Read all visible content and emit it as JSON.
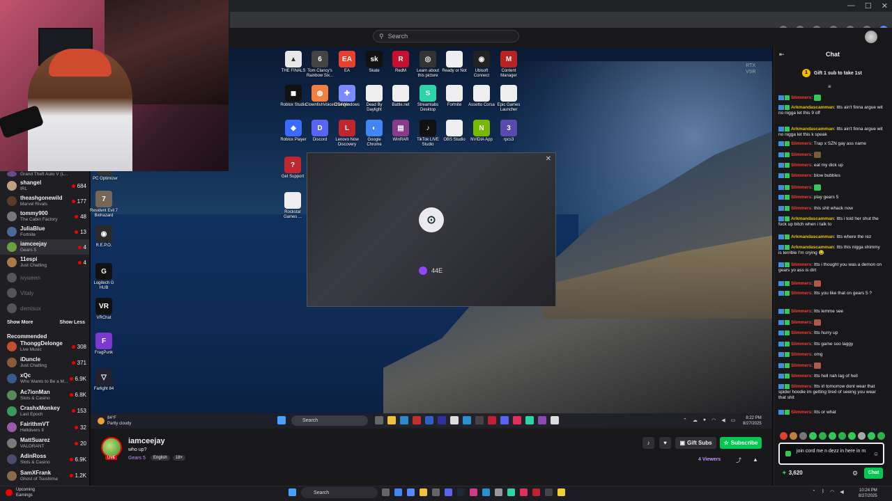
{
  "browser": {
    "window_controls": [
      "—",
      "☐",
      "✕"
    ]
  },
  "twitch_header": {
    "search_placeholder": "Search"
  },
  "sidebar": {
    "followed": [
      {
        "name": "Grand Theft Auto V (L...",
        "game": "",
        "count": "",
        "color": "#6a4a8a",
        "partial": true
      },
      {
        "name": "shangel",
        "game": "IRL",
        "count": "684",
        "color": "#c0a080"
      },
      {
        "name": "theashgonewild",
        "game": "Marvel Rivals",
        "count": "177",
        "color": "#5a3a2a"
      },
      {
        "name": "tommy900",
        "game": "The Cabin Factory",
        "count": "48",
        "color": "#777"
      },
      {
        "name": "JuliaBlue",
        "game": "Fortnite",
        "count": "13",
        "color": "#4a6a9a"
      },
      {
        "name": "iamceejay",
        "game": "Gears 5",
        "count": "4",
        "color": "#6aa040",
        "active": true
      },
      {
        "name": "11espi",
        "game": "Just Chatting",
        "count": "4",
        "color": "#aa7a4a"
      },
      {
        "name": "ivyween",
        "game": "",
        "count": "",
        "color": "#555",
        "offline": true
      },
      {
        "name": "Vitaly",
        "game": "",
        "count": "",
        "color": "#555",
        "offline": true
      },
      {
        "name": "demisux",
        "game": "",
        "count": "",
        "color": "#555",
        "offline": true
      }
    ],
    "show_more": "Show More",
    "show_less": "Show Less",
    "recommended_title": "Recommended",
    "recommended": [
      {
        "name": "ThonggDelonge",
        "game": "Live Music",
        "count": "308",
        "color": "#c05030"
      },
      {
        "name": "iDuncle",
        "game": "Just Chatting",
        "count": "371",
        "color": "#8a5a3a"
      },
      {
        "name": "xQc",
        "game": "Who Wants to Be a M...",
        "count": "6.9K",
        "color": "#3a5a8a"
      },
      {
        "name": "Ac7ionMan",
        "game": "Slots & Casino",
        "count": "6.8K",
        "color": "#5a8a5a"
      },
      {
        "name": "CrashxMonkey",
        "game": "Last Epoch",
        "count": "153",
        "color": "#3a9a5a"
      },
      {
        "name": "FairithmVT",
        "game": "Helldivers II",
        "count": "32",
        "color": "#9a5aaa"
      },
      {
        "name": "MattSuarez",
        "game": "VALORANT",
        "count": "20",
        "color": "#7a7a7a"
      },
      {
        "name": "AdinRoss",
        "game": "Slots & Casino",
        "count": "6.9K",
        "color": "#4a4a6a"
      },
      {
        "name": "SamXFrank",
        "game": "Ghost of Tsushima",
        "count": "1.2K",
        "color": "#8a6a4a"
      }
    ]
  },
  "desktop": {
    "rtx_label": "RTX\nVSR",
    "icons": [
      {
        "label": "THE FINALS",
        "color": "#e8e8e8",
        "glyph": "▲"
      },
      {
        "label": "Tom Clancy's Rainbow Six...",
        "color": "#444",
        "glyph": "6"
      },
      {
        "label": "EA",
        "color": "#e8402c",
        "glyph": "EA"
      },
      {
        "label": "Skate",
        "color": "#111",
        "glyph": "sk"
      },
      {
        "label": "RedM",
        "color": "#c8102e",
        "glyph": "R"
      },
      {
        "label": "Learn about this picture",
        "color": "#333",
        "glyph": "◎"
      },
      {
        "label": "Ready or Not",
        "color": "#eee",
        "glyph": ""
      },
      {
        "label": "Ubisoft Connect",
        "color": "#222",
        "glyph": "◉"
      },
      {
        "label": "Content Manager",
        "color": "#b22",
        "glyph": "M"
      },
      {
        "label": "Roblox Studio",
        "color": "#111",
        "glyph": "◼"
      },
      {
        "label": "ClownfishVoiceChanger",
        "color": "#f08040",
        "glyph": "◍"
      },
      {
        "label": "DS4Windows",
        "color": "#7a8aff",
        "glyph": "✚"
      },
      {
        "label": "Dead By Daylight",
        "color": "#eee",
        "glyph": ""
      },
      {
        "label": "Battle.net",
        "color": "#eee",
        "glyph": ""
      },
      {
        "label": "Streamlabs Desktop",
        "color": "#2dd4a6",
        "glyph": "S"
      },
      {
        "label": "Fortnite",
        "color": "#eee",
        "glyph": ""
      },
      {
        "label": "Assetto Corsa",
        "color": "#eee",
        "glyph": ""
      },
      {
        "label": "Epic Games Launcher",
        "color": "#eee",
        "glyph": ""
      },
      {
        "label": "Roblox Player",
        "color": "#3a6aff",
        "glyph": "◆"
      },
      {
        "label": "Discord",
        "color": "#5865f2",
        "glyph": "D"
      },
      {
        "label": "Lenovo Now Discovery",
        "color": "#c0262e",
        "glyph": "L"
      },
      {
        "label": "Google Chrome",
        "color": "#4285f4",
        "glyph": "◐"
      },
      {
        "label": "WinRAR",
        "color": "#8a3a8a",
        "glyph": "▤"
      },
      {
        "label": "TikTok LIVE Studio",
        "color": "#111",
        "glyph": "♪"
      },
      {
        "label": "OBS Studio",
        "color": "#eee",
        "glyph": ""
      },
      {
        "label": "NVIDIA App",
        "color": "#76b900",
        "glyph": "N"
      },
      {
        "label": "rpcs3",
        "color": "#5a4ab0",
        "glyph": "3"
      },
      {
        "label": "Get Support",
        "color": "#c0262e",
        "glyph": "?"
      },
      {
        "label": "Rockstar Games ...",
        "color": "#eee",
        "glyph": ""
      },
      {
        "label": "PC Optimizer",
        "color": "#333",
        "glyph": ""
      },
      {
        "label": "Resident Evil 7 Biohazard",
        "color": "#776655",
        "glyph": "7"
      },
      {
        "label": "R.E.P.O.",
        "color": "#2a2a2a",
        "glyph": "◉"
      },
      {
        "label": "Logitech G HUB",
        "color": "#111",
        "glyph": "G"
      },
      {
        "label": "VRChat",
        "color": "#111",
        "glyph": "VR"
      },
      {
        "label": "FragPunk",
        "color": "#7a3ad0",
        "glyph": "F"
      },
      {
        "label": "Farlight 84",
        "color": "#223",
        "glyph": "▽"
      }
    ],
    "steam_username": "44E",
    "steam_close": "✕"
  },
  "desktop_taskbar": {
    "weather_temp": "84°F",
    "weather_text": "Partly cloudy",
    "search": "Search",
    "time": "8:22 PM",
    "date": "8/27/2025"
  },
  "stream": {
    "channel": "iamceejay",
    "title": "who up?",
    "game": "Gears 5",
    "tags": [
      "English",
      "18+"
    ],
    "live": "LIVE",
    "gift_subs": "Gift Subs",
    "subscribe": "Subscribe",
    "viewers": "4 Viewers"
  },
  "chat": {
    "title": "Chat",
    "gift_banner": "Gift 1 sub to take 1st",
    "gift_count": "1",
    "messages": [
      {
        "user": "Slimmers",
        "ucolor": "#ff3b30",
        "text": "",
        "emote": "#34c759"
      },
      {
        "user": "Arkmandascamman",
        "ucolor": "#e6c200",
        "text": "Itts ain't finna argue wit no nigga let this 9 off"
      },
      {
        "user": "Arkmandascamman",
        "ucolor": "#e6c200",
        "text": "Itts ain't finna argue wit no nigga let this k speak"
      },
      {
        "user": "Slimmers",
        "ucolor": "#ff3b30",
        "text": "Trap x SZN gay ass name"
      },
      {
        "user": "Slimmers",
        "ucolor": "#ff3b30",
        "text": "",
        "emote": "#7a5a3a"
      },
      {
        "user": "Slimmers",
        "ucolor": "#ff3b30",
        "text": "eat my dick up"
      },
      {
        "user": "Slimmers",
        "ucolor": "#ff3b30",
        "text": "blow bubbles"
      },
      {
        "user": "Slimmers",
        "ucolor": "#ff3b30",
        "text": "",
        "emote": "#34c759"
      },
      {
        "user": "Slimmers",
        "ucolor": "#ff3b30",
        "text": "play gears 5"
      },
      {
        "user": "Slimmers",
        "ucolor": "#ff3b30",
        "text": "this shit whack now"
      },
      {
        "user": "Arkmandascamman",
        "ucolor": "#e6c200",
        "text": "Itts i told her shut the fuck up bitch when i talk to"
      },
      {
        "user": "Arkmandascamman",
        "ucolor": "#e6c200",
        "text": "Itts where the rez"
      },
      {
        "user": "Arkmandascamman",
        "ucolor": "#e6c200",
        "text": "Itts this nigga shimmy is terrible I'm crying 😂"
      },
      {
        "user": "Slimmers",
        "ucolor": "#ff3b30",
        "text": "Itts i thought you was a demon on gears yo ass is dirt"
      },
      {
        "user": "Slimmers",
        "ucolor": "#ff3b30",
        "text": "",
        "emote": "#b05a4a"
      },
      {
        "user": "Slimmers",
        "ucolor": "#ff3b30",
        "text": "Itts you like that on gears 5 ?"
      },
      {
        "user": "Slimmers",
        "ucolor": "#ff3b30",
        "text": "Itts lemme see"
      },
      {
        "user": "Slimmers",
        "ucolor": "#ff3b30",
        "text": "",
        "emote": "#b05a4a"
      },
      {
        "user": "Slimmers",
        "ucolor": "#ff3b30",
        "text": "Itts hurry up"
      },
      {
        "user": "Slimmers",
        "ucolor": "#ff3b30",
        "text": "Itts game soo laggy"
      },
      {
        "user": "Slimmers",
        "ucolor": "#ff3b30",
        "text": "omg"
      },
      {
        "user": "Slimmers",
        "ucolor": "#ff3b30",
        "text": "",
        "emote": "#b05a4a"
      },
      {
        "user": "Slimmers",
        "ucolor": "#ff3b30",
        "text": "Itts hell nah lag of hell"
      },
      {
        "user": "Slimmers",
        "ucolor": "#ff3b30",
        "text": "Itts irl tomorrow dont wear that spider hoodie im getting tired of seeing you wear that shit"
      },
      {
        "user": "Slimmers",
        "ucolor": "#ff3b30",
        "text": "Itts or what"
      }
    ],
    "input_value": "join cord me n dezz in here in m",
    "points": "3,620",
    "send": "Chat"
  },
  "win_taskbar": {
    "upcoming": "Upcoming",
    "upcoming_sub": "Earnings",
    "search": "Search",
    "time": "10:24 PM",
    "date": "8/27/2025"
  }
}
